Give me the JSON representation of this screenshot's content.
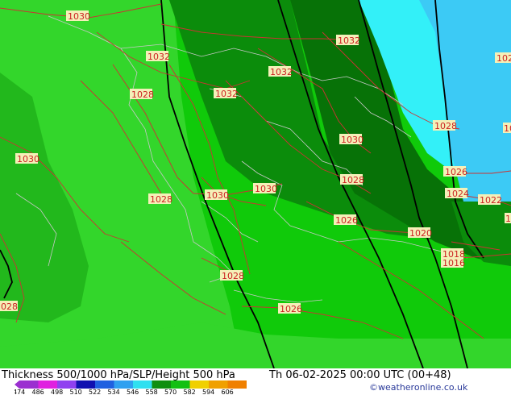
{
  "map": {
    "pressure_labels": [
      {
        "text": "1030"
      },
      {
        "text": "1032"
      },
      {
        "text": "1028"
      },
      {
        "text": "1032"
      },
      {
        "text": "1032"
      },
      {
        "text": "1032"
      },
      {
        "text": "1030"
      },
      {
        "text": "1030"
      },
      {
        "text": "1028"
      },
      {
        "text": "1030"
      },
      {
        "text": "1030"
      },
      {
        "text": "1028"
      },
      {
        "text": "1026"
      },
      {
        "text": "1028"
      },
      {
        "text": "1026"
      },
      {
        "text": "1024"
      },
      {
        "text": "1022"
      },
      {
        "text": "1020"
      },
      {
        "text": "1018"
      },
      {
        "text": "1016"
      },
      {
        "text": "1028"
      },
      {
        "text": "1026"
      },
      {
        "text": "1028"
      },
      {
        "text": "102"
      },
      {
        "text": "10"
      },
      {
        "text": "1"
      }
    ],
    "colors": {
      "light_green": "#33d62b",
      "mid_green": "#22b81c",
      "bright_green": "#10ca0a",
      "dark_green": "#0b8c0b",
      "darker_green": "#077207",
      "cyan": "#33f0f8",
      "sky_blue": "#3ccaf5",
      "isobar": "#cc3333",
      "coast": "#c8c8c8",
      "height_line": "#000000"
    }
  },
  "footer": {
    "title": "Thickness 500/1000 hPa/SLP/Height 500 hPa",
    "valid": "Th 06-02-2025 00:00 UTC (00+48)",
    "credit": "©weatheronline.co.uk"
  },
  "legend": {
    "ticks": [
      "474",
      "486",
      "498",
      "510",
      "522",
      "534",
      "546",
      "558",
      "570",
      "582",
      "594",
      "606"
    ],
    "colors": [
      "#9b30d0",
      "#e020e0",
      "#9040f0",
      "#1010b0",
      "#2060e0",
      "#30a0f0",
      "#30e0f0",
      "#0f8f0f",
      "#12c012",
      "#f0d000",
      "#f0a000",
      "#f08000"
    ]
  }
}
